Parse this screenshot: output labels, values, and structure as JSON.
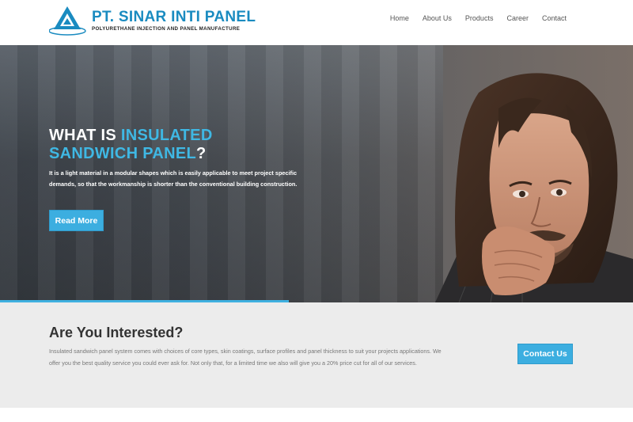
{
  "header": {
    "logo_title_a": "PT. SINAR ",
    "logo_title_b": "INTI PANEL",
    "logo_subtitle": "POLYURETHANE INJECTION AND PANEL MANUFACTURE",
    "nav": [
      "Home",
      "About Us",
      "Products",
      "Career",
      "Contact"
    ]
  },
  "hero": {
    "heading_line1_a": "WHAT IS ",
    "heading_line1_b": "INSULATED",
    "heading_line2_a": "SANDWICH PANEL",
    "heading_line2_b": "?",
    "text": "It is a light material in a modular shapes which is easily applicable to meet project specific demands, so that the workmanship is shorter than the conventional building construction.",
    "button": "Read More"
  },
  "cta": {
    "title": "Are You Interested?",
    "text": "Insulated sandwich panel system comes with choices of core types, skin coatings, surface profiles and panel thickness to suit your projects applications. We offer you the best quality service you could ever ask for. Not only that, for a limited time we also will give you a 20% price cut for all of our services.",
    "button": "Contact Us"
  },
  "colors": {
    "accent": "#3caee0",
    "brand": "#1a8bc0"
  }
}
